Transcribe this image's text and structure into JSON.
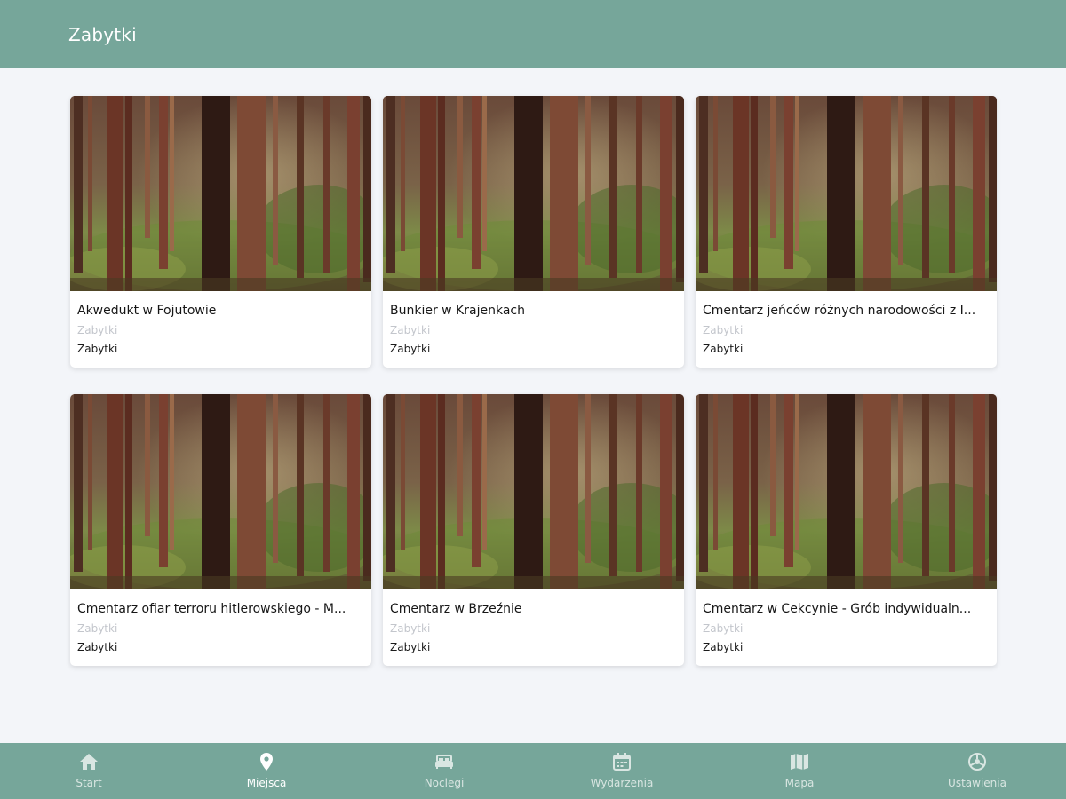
{
  "header": {
    "title": "Zabytki"
  },
  "colors": {
    "primary": "#76a69a",
    "background": "#f3f5f9",
    "nav_inactive": "#d9e6e2",
    "nav_active": "#ffffff"
  },
  "cards": [
    {
      "title": "Akwedukt w Fojutowie",
      "subtitle": "Zabytki",
      "category": "Zabytki",
      "image": "forest-photo"
    },
    {
      "title": "Bunkier w Krajenkach",
      "subtitle": "Zabytki",
      "category": "Zabytki",
      "image": "forest-photo"
    },
    {
      "title": "Cmentarz jeńców różnych narodowości z I...",
      "subtitle": "Zabytki",
      "category": "Zabytki",
      "image": "forest-photo"
    },
    {
      "title": "Cmentarz ofiar terroru hitlerowskiego - M...",
      "subtitle": "Zabytki",
      "category": "Zabytki",
      "image": "forest-photo"
    },
    {
      "title": "Cmentarz w Brzeźnie",
      "subtitle": "Zabytki",
      "category": "Zabytki",
      "image": "forest-photo"
    },
    {
      "title": "Cmentarz w Cekcynie - Grób indywidualn...",
      "subtitle": "Zabytki",
      "category": "Zabytki",
      "image": "forest-photo"
    }
  ],
  "bottom_nav": {
    "active_index": 1,
    "items": [
      {
        "label": "Start",
        "icon": "home-icon"
      },
      {
        "label": "Miejsca",
        "icon": "map-pin-icon"
      },
      {
        "label": "Noclegi",
        "icon": "bed-icon"
      },
      {
        "label": "Wydarzenia",
        "icon": "calendar-icon"
      },
      {
        "label": "Mapa",
        "icon": "map-icon"
      },
      {
        "label": "Ustawienia",
        "icon": "settings-icon"
      }
    ]
  }
}
